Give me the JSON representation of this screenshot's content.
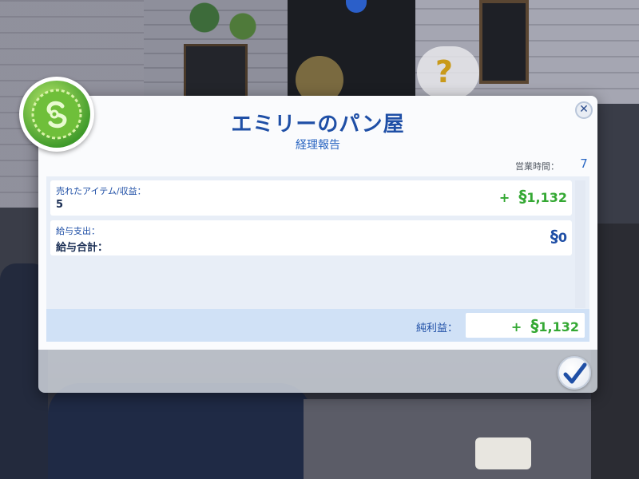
{
  "dialog": {
    "title": "エミリーのパン屋",
    "subtitle": "経理報告",
    "close_label": "✕",
    "hours_label": "営業時間：",
    "hours_value": "7"
  },
  "rows": {
    "sales": {
      "label": "売れたアイテム/収益：",
      "value": "5",
      "sign": "+",
      "currency_symbol": "§",
      "amount": "1,132"
    },
    "payroll": {
      "label": "給与支出：",
      "total_label": "給与合計：",
      "currency_symbol": "§",
      "amount": "0"
    }
  },
  "net": {
    "label": "純利益：",
    "sign": "+",
    "currency_symbol": "§",
    "amount": "1,132"
  },
  "icons": {
    "badge": "simoleon-badge-icon",
    "close": "close-icon",
    "confirm": "checkmark-icon",
    "hint_bubble": "question-mark-icon"
  },
  "scene": {
    "hint_text": "?"
  },
  "colors": {
    "title_blue": "#1f4fa6",
    "positive_green": "#34a833",
    "panel_bg": "#e8eef7",
    "net_bar_bg": "#d0e1f6"
  }
}
